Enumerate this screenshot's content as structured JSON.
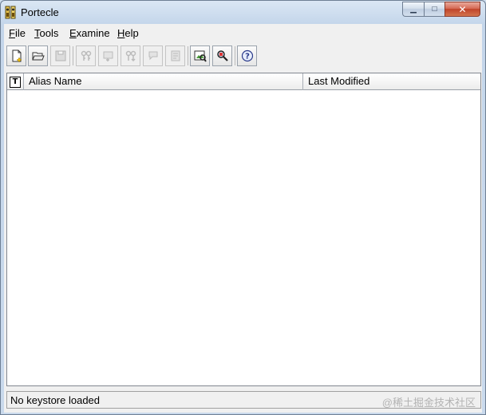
{
  "window": {
    "title": "Portecle",
    "close_glyph": "✕",
    "minimize_glyph": "▁",
    "maximize_glyph": "□"
  },
  "menu": [
    {
      "label": "File"
    },
    {
      "label": "Tools"
    },
    {
      "label": "Examine"
    },
    {
      "label": "Help"
    }
  ],
  "toolbar": [
    {
      "icon": "new-keystore-icon",
      "enabled": true
    },
    {
      "icon": "open-keystore-icon",
      "enabled": true
    },
    {
      "icon": "save-keystore-icon",
      "enabled": false
    },
    {
      "icon": "generate-keypair-icon",
      "enabled": false
    },
    {
      "icon": "import-certificate-icon",
      "enabled": false
    },
    {
      "icon": "import-keypair-icon",
      "enabled": false
    },
    {
      "icon": "set-password-icon",
      "enabled": false
    },
    {
      "icon": "keystore-report-icon",
      "enabled": false
    },
    {
      "icon": "examine-certificate-icon",
      "enabled": true
    },
    {
      "icon": "examine-ssl-icon",
      "enabled": true
    },
    {
      "icon": "help-icon",
      "enabled": true
    }
  ],
  "table": {
    "type_header_glyph": "T",
    "columns": [
      "Alias Name",
      "Last Modified"
    ],
    "rows": []
  },
  "status": {
    "text": "No keystore loaded"
  },
  "watermark": "@稀土掘金技术社区"
}
